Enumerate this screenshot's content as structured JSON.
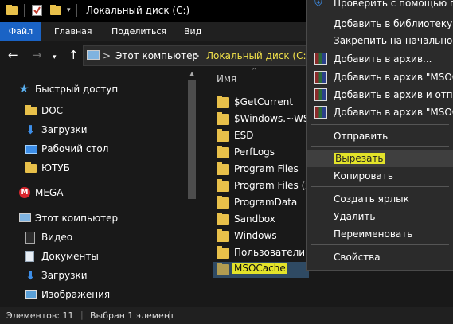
{
  "window": {
    "title": "Локальный диск (C:)"
  },
  "ribbon": {
    "tabs": [
      "Файл",
      "Главная",
      "Поделиться",
      "Вид"
    ]
  },
  "address": {
    "crumbs": [
      "Этот компьютер",
      "Локальный диск (C:)"
    ],
    "separator": ">"
  },
  "sidebar": {
    "items": [
      {
        "label": "Быстрый доступ",
        "icon": "star-icon"
      },
      {
        "label": "DOC",
        "icon": "folder-icon"
      },
      {
        "label": "Загрузки",
        "icon": "download-icon"
      },
      {
        "label": "Рабочий стол",
        "icon": "desktop-icon"
      },
      {
        "label": "ЮТУБ",
        "icon": "folder-icon"
      },
      {
        "label": "MEGA",
        "icon": "mega-icon"
      },
      {
        "label": "Этот компьютер",
        "icon": "computer-icon"
      },
      {
        "label": "Видео",
        "icon": "video-icon"
      },
      {
        "label": "Документы",
        "icon": "documents-icon"
      },
      {
        "label": "Загрузки",
        "icon": "download-icon"
      },
      {
        "label": "Изображения",
        "icon": "pictures-icon"
      }
    ]
  },
  "filelist": {
    "column_name": "Имя",
    "rows": [
      {
        "name": "$GetCurrent"
      },
      {
        "name": "$Windows.~WS"
      },
      {
        "name": "ESD"
      },
      {
        "name": "PerfLogs"
      },
      {
        "name": "Program Files"
      },
      {
        "name": "Program Files (x8"
      },
      {
        "name": "ProgramData"
      },
      {
        "name": "Sandbox"
      },
      {
        "name": "Windows"
      },
      {
        "name": "Пользователи"
      },
      {
        "name": "MSOCache",
        "selected": true
      }
    ],
    "peek_date": "20.07.2"
  },
  "context_menu": {
    "items": [
      {
        "label": "Проверить с помощью про",
        "icon": "defender-icon"
      },
      {
        "label": "Добавить в библиотеку",
        "icon": ""
      },
      {
        "label": "Закрепить на начальном э",
        "icon": ""
      },
      {
        "label": "Добавить в архив...",
        "icon": "winrar-icon"
      },
      {
        "label": "Добавить в архив \"MSOCach",
        "icon": "winrar-icon"
      },
      {
        "label": "Добавить в архив и отправи",
        "icon": "winrar-icon"
      },
      {
        "label": "Добавить в архив \"MSOCac",
        "icon": "winrar-icon"
      },
      {
        "label": "Отправить",
        "icon": ""
      },
      {
        "label": "Вырезать",
        "icon": "",
        "highlighted": true
      },
      {
        "label": "Копировать",
        "icon": ""
      },
      {
        "label": "Создать ярлык",
        "icon": ""
      },
      {
        "label": "Удалить",
        "icon": ""
      },
      {
        "label": "Переименовать",
        "icon": ""
      },
      {
        "label": "Свойства",
        "icon": ""
      }
    ]
  },
  "statusbar": {
    "count": "Элементов: 11",
    "selected": "Выбран 1 элемент"
  },
  "colors": {
    "accent": "#1a63c5",
    "highlight_marker": "#dede25",
    "folder": "#e8c04a"
  }
}
